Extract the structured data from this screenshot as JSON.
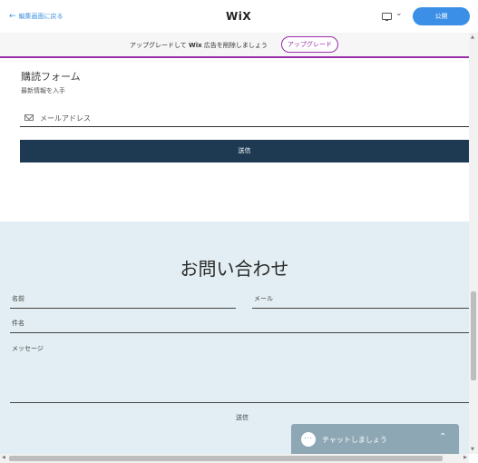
{
  "topbar": {
    "back_label": "編集画面に戻る",
    "logo": "WiX",
    "publish_label": "公開"
  },
  "banner": {
    "text_before": "アップグレードして ",
    "text_brand": "Wix",
    "text_after": " 広告を削除しましょう",
    "upgrade_label": "アップグレード"
  },
  "subscribe": {
    "title": "購読フォーム",
    "subtitle": "最新情報を入手",
    "email_placeholder": "メールアドレス",
    "submit_label": "送信"
  },
  "contact": {
    "title": "お問い合わせ",
    "name_label": "名前",
    "email_label": "メール",
    "subject_label": "件名",
    "message_label": "メッセージ",
    "send_label": "送信"
  },
  "chat": {
    "label": "チャットしましょう"
  },
  "colors": {
    "accent_blue": "#3b8fe6",
    "upgrade_purple": "#9b2fa8",
    "submit_dark": "#1d3a52",
    "contact_bg": "#e2eef3",
    "chat_bg": "#8ea7b4"
  },
  "icons": [
    "arrow-left-icon",
    "desktop-icon",
    "chevron-down-icon",
    "mail-icon",
    "chat-bubble-icon",
    "chevron-up-icon"
  ]
}
